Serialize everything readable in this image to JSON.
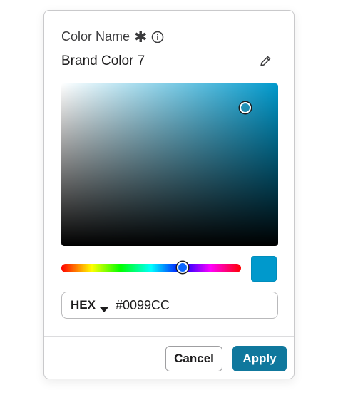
{
  "field": {
    "label": "Color Name",
    "required_marker": "✱",
    "info_icon": "info-icon",
    "value": "Brand Color 7",
    "edit_icon": "pencil-icon"
  },
  "picker": {
    "current_color": "#0099CC",
    "format": "HEX",
    "hex_value": "#0099CC"
  },
  "actions": {
    "cancel_label": "Cancel",
    "apply_label": "Apply"
  },
  "colors": {
    "accent": "#10789D",
    "swatch": "#0099CC"
  }
}
